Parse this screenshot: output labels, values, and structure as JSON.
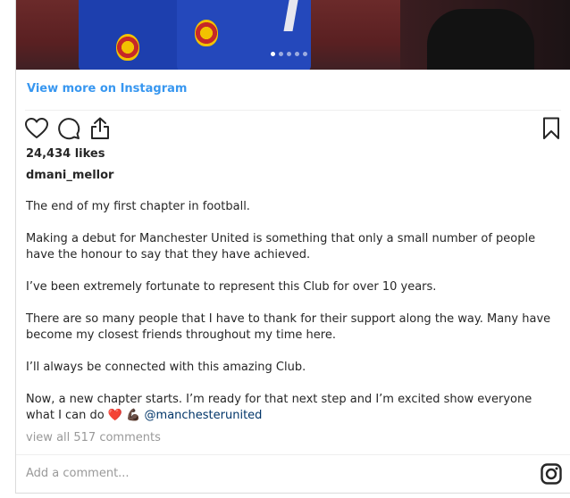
{
  "post": {
    "view_more": "View more on Instagram",
    "likes": "24,434 likes",
    "username": "dmani_mellor",
    "caption": [
      "The end of my first chapter in football.",
      "Making a debut for Manchester United is something that only a small number of people have the honour to say that they have achieved.",
      "I’ve been extremely fortunate to represent this Club for over 10 years.",
      "There are so many people that I have to thank for their support along the way. Many have become my closest friends throughout my time here.",
      "I’ll always be connected with this amazing Club."
    ],
    "last_paragraph_text": "Now, a new chapter starts. I’m ready for that next step and I’m excited show everyone what I can do",
    "last_paragraph_emoji_heart": "❤️",
    "last_paragraph_emoji_flex": "💪🏿",
    "mention": "@manchesterunited",
    "view_comments": "view all 517 comments",
    "comment_placeholder": "Add a comment..."
  },
  "icons": {
    "like": "heart-outline-icon",
    "comment": "comment-bubble-icon",
    "share": "share-upload-icon",
    "save": "bookmark-icon",
    "brand": "instagram-logo-icon"
  },
  "colors": {
    "link_blue": "#3897f0",
    "mention": "#003569",
    "muted": "#999999",
    "text": "#262626"
  },
  "carousel": {
    "slides": 5,
    "active_index": 0
  }
}
